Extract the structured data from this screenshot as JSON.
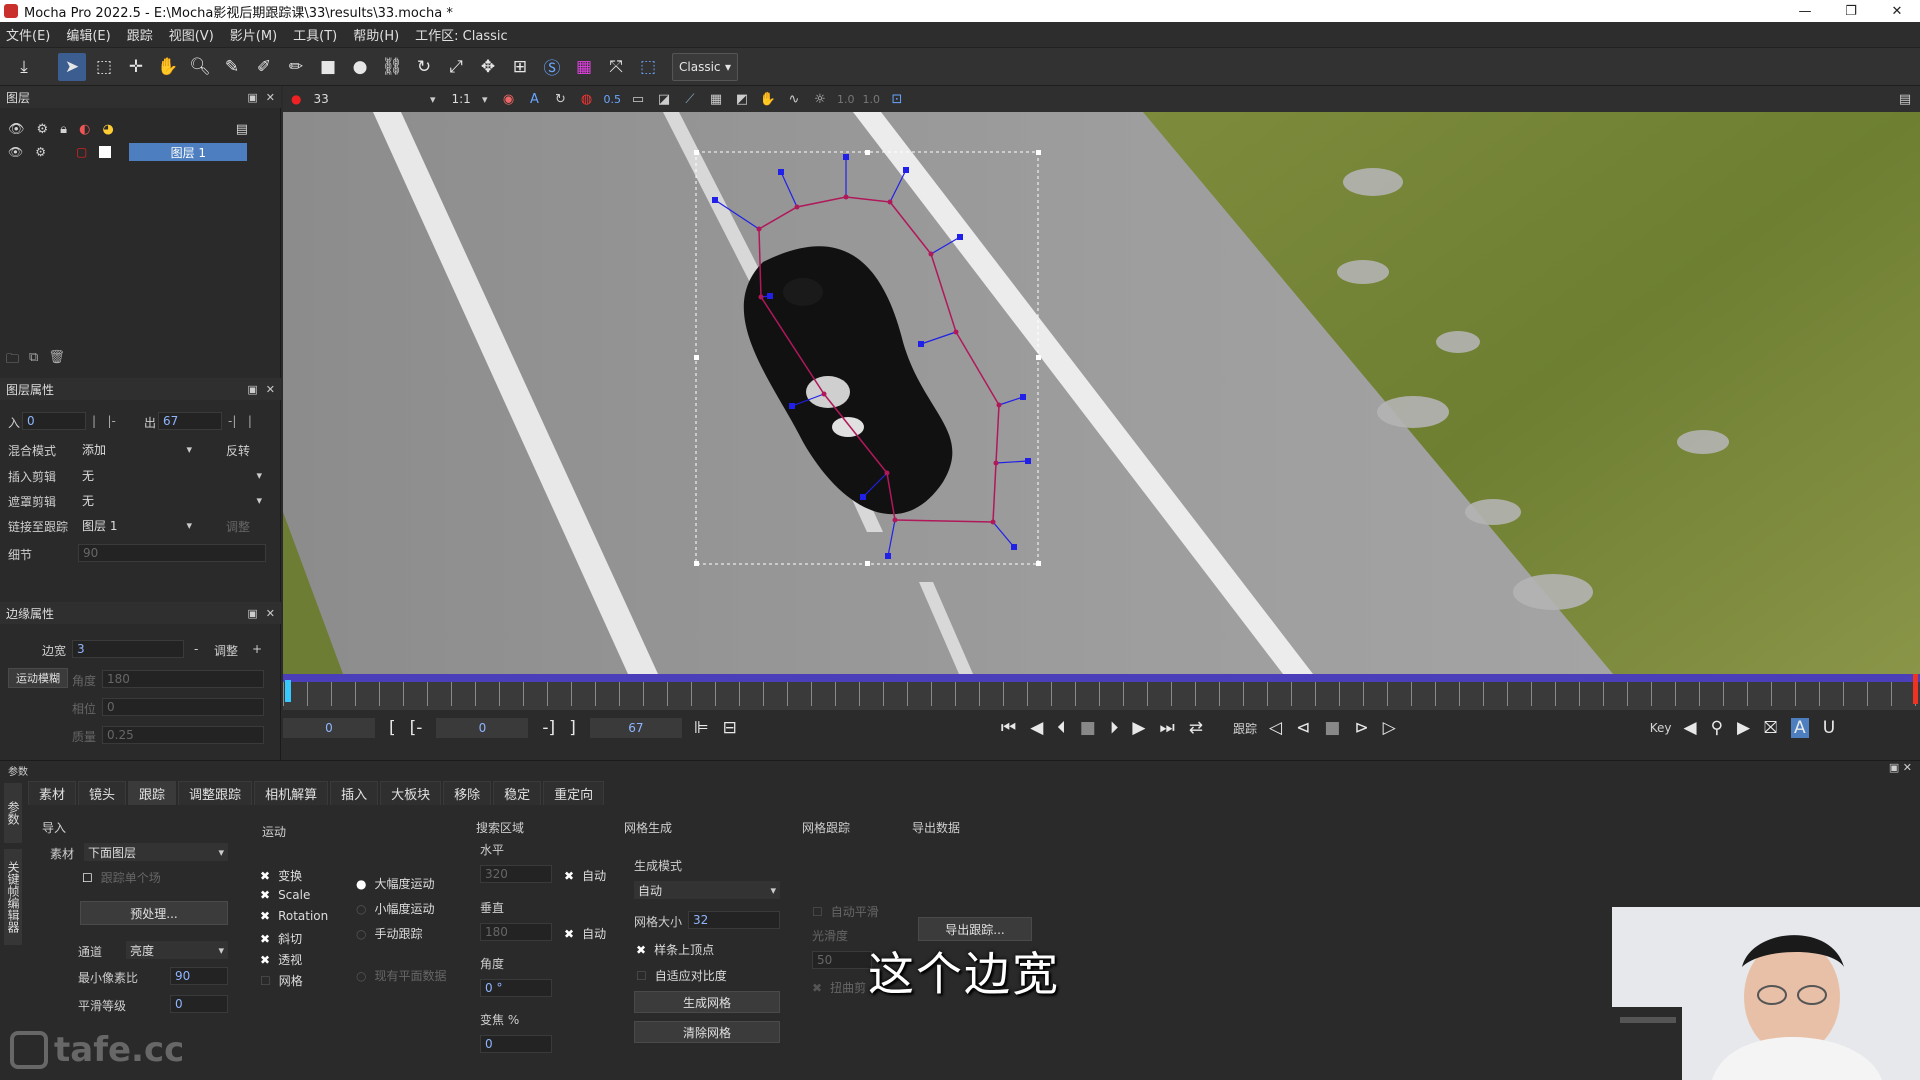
{
  "window": {
    "title": "Mocha Pro 2022.5 - E:\\Mocha影视后期跟踪课\\33\\results\\33.mocha *",
    "minimize": "—",
    "restore": "❐",
    "close": "✕"
  },
  "menu": [
    "文件(E)",
    "编辑(E)",
    "跟踪",
    "视图(V)",
    "影片(M)",
    "工具(T)",
    "帮助(H)",
    "工作区: Classic"
  ],
  "toolbar": {
    "workspace": "Classic",
    "icons": [
      "download-icon",
      "select-icon",
      "select-points-icon",
      "add-point-icon",
      "hand-icon",
      "zoom-icon",
      "bspline-icon",
      "xspline-icon",
      "brush-icon",
      "rect-icon",
      "circle-icon",
      "link-icon",
      "rotate-icon",
      "scale-icon",
      "move-icon",
      "grid-icon",
      "s-icon",
      "mesh-icon",
      "fit-icon",
      "surface-icon"
    ]
  },
  "layers_panel": {
    "title": "图层",
    "layer_name": "图层 1"
  },
  "layer_props": {
    "title": "图层属性",
    "in_label": "入",
    "in_value": "0",
    "out_label": "出",
    "out_value": "67",
    "blend_label": "混合模式",
    "blend_value": "添加",
    "invert_label": "反转",
    "insert_label": "插入剪辑",
    "insert_value": "无",
    "matte_label": "遮罩剪辑",
    "matte_value": "无",
    "link_label": "链接至跟踪",
    "link_value": "图层 1",
    "adjust_label": "调整",
    "detail_label": "细节",
    "detail_value": "90"
  },
  "edge_props": {
    "title": "边缘属性",
    "edge_label": "边宽",
    "edge_value": "3",
    "adjust_btn": "调整",
    "minus": "-",
    "plus": "+",
    "motion_blur": "运动模糊",
    "angle_label": "角度",
    "angle_value": "180",
    "phase_label": "相位",
    "phase_value": "0",
    "quality_label": "质量",
    "quality_value": "0.25"
  },
  "viewer": {
    "frame": "33",
    "zoom": "1:1",
    "opacity": "0.5",
    "val1": "1.0",
    "val2": "1.0"
  },
  "transport": {
    "start": "0",
    "in": "0",
    "out": "67",
    "track_label": "跟踪",
    "key_label": "Key"
  },
  "params_label": "参数",
  "tabs": [
    "素材",
    "镜头",
    "跟踪",
    "调整跟踪",
    "相机解算",
    "插入",
    "大板块",
    "移除",
    "稳定",
    "重定向"
  ],
  "side_tab_2": "关键帧编辑器",
  "track": {
    "import": "导入",
    "clip_label": "素材",
    "clip_value": "下面图层",
    "track_single": "跟踪单个场",
    "preprocess": "预处理...",
    "channel_label": "通道",
    "channel_value": "亮度",
    "min_pixel_label": "最小像素比",
    "min_pixel_value": "90",
    "smooth_label": "平滑等级",
    "smooth_value": "0",
    "motion": "运动",
    "m_translate": "变换",
    "m_scale": "Scale",
    "m_rotation": "Rotation",
    "m_shear": "斜切",
    "m_perspective": "透视",
    "m_grid": "网格",
    "large": "大幅度运动",
    "small": "小幅度运动",
    "manual": "手动跟踪",
    "existing": "现有平面数据",
    "search_area": "搜索区域",
    "horizontal": "水平",
    "h_value": "320",
    "vertical": "垂直",
    "v_value": "180",
    "auto": "自动",
    "angle": "角度",
    "angle_value": "0 °",
    "zoom": "变焦 %",
    "zoom_value": "0",
    "mesh_gen": "网格生成",
    "gen_mode": "生成模式",
    "gen_mode_value": "自动",
    "mesh_size": "网格大小",
    "mesh_size_value": "32",
    "spline_vertex": "样条上顶点",
    "adaptive": "自适应对比度",
    "gen_mesh": "生成网格",
    "clear_mesh": "清除网格",
    "mesh_track": "网格跟踪",
    "auto_smooth": "自动平滑",
    "smoothness": "光滑度",
    "smooth_v": "50",
    "distort": "扭曲剪",
    "export_data": "导出数据",
    "export_btn": "导出跟踪..."
  },
  "subtitle": "这个边宽",
  "watermark": "tafe.cc",
  "colors": {
    "spline": "#b0185a",
    "handle": "#2020e8",
    "selected_layer": "#4d7fc0",
    "timebar": "#4a3fb8"
  }
}
